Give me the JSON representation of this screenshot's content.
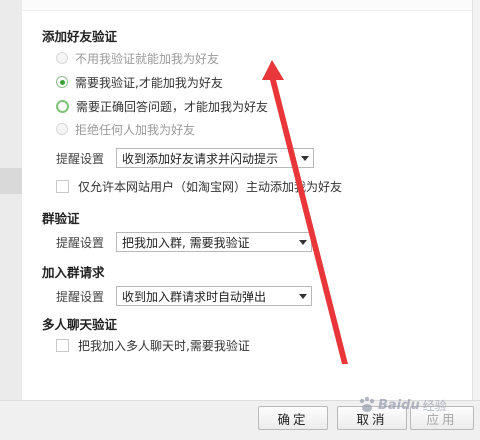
{
  "sections": {
    "add_friend": {
      "title": "添加好友验证",
      "options": [
        {
          "label": "不用我验证就能加我为好友",
          "state": "disabled"
        },
        {
          "label": "需要我验证,才能加我为好友",
          "state": "checked"
        },
        {
          "label": "需要正确回答问题，才能加我为好友",
          "state": "focus"
        },
        {
          "label": "拒绝任何人加我为好友",
          "state": "disabled"
        }
      ],
      "reminder_label": "提醒设置",
      "reminder_value": "收到添加好友请求并闪动提示",
      "site_only_label": "仅允许本网站用户（如淘宝网）主动添加我为好友"
    },
    "group_verify": {
      "title": "群验证",
      "reminder_label": "提醒设置",
      "reminder_value": "把我加入群, 需要我验证"
    },
    "join_group": {
      "title": "加入群请求",
      "reminder_label": "提醒设置",
      "reminder_value": "收到加入群请求时自动弹出"
    },
    "multi_chat": {
      "title": "多人聊天验证",
      "check_label": "把我加入多人聊天时,需要我验证"
    }
  },
  "footer": {
    "ok_label": "确定",
    "cancel_label": "取消",
    "apply_label": "应用"
  },
  "watermark": {
    "brand": "Baidu",
    "suffix": "经验"
  },
  "colors": {
    "radio_checked": "#3aa33a",
    "annotation_arrow": "#e8363a"
  }
}
